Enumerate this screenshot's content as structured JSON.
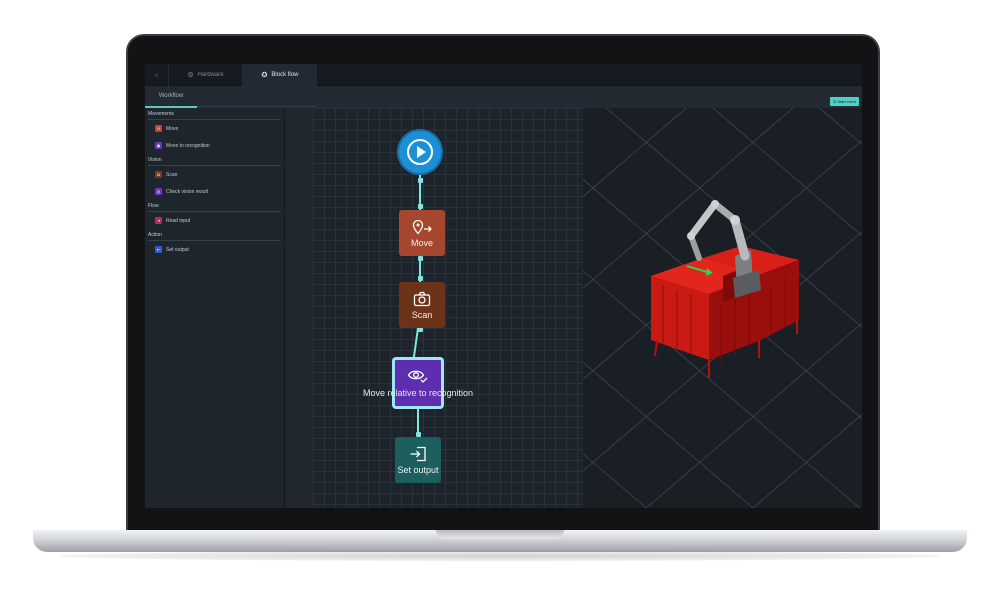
{
  "tabs": {
    "home_icon": "home-icon",
    "hardware_label": "Hardware",
    "block_flow_label": "Block flow"
  },
  "subbar": {
    "workflow_tab": "Workflow",
    "start_robot": "Start robot"
  },
  "palette": {
    "categories": [
      {
        "label": "Movements",
        "items": [
          {
            "label": "Move",
            "icon": "move-icon",
            "color": "#c0452b"
          },
          {
            "label": "Move to recognition",
            "icon": "recognition-icon",
            "color": "#6a35c4"
          }
        ]
      },
      {
        "label": "Vision",
        "items": [
          {
            "label": "Scan",
            "icon": "camera-icon",
            "color": "#7a3c1c"
          },
          {
            "label": "Check vision result",
            "icon": "eye-check-icon",
            "color": "#6a35c4"
          }
        ]
      },
      {
        "label": "Flow",
        "items": [
          {
            "label": "Read input",
            "icon": "input-icon",
            "color": "#b02a5a"
          }
        ]
      },
      {
        "label": "Action",
        "items": [
          {
            "label": "Set output",
            "icon": "output-icon",
            "color": "#2f5fc4"
          }
        ]
      }
    ]
  },
  "flow": {
    "start_icon": "play-icon",
    "nodes": {
      "move": {
        "label": "Move",
        "icon": "location-arrow-icon"
      },
      "scan": {
        "label": "Scan",
        "icon": "camera-icon"
      },
      "move_relative": {
        "label": "Move relative to recognition",
        "icon": "eye-check-icon"
      },
      "set_output": {
        "label": "Set output",
        "icon": "output-icon"
      }
    }
  },
  "colors": {
    "accent": "#4fd1c5",
    "connector": "#7fe6e0",
    "start_node": "#1c8fd6",
    "move": "#a4472e",
    "scan": "#6c3318",
    "move_relative": "#5d2fb0",
    "set_output": "#1d5f5f",
    "cell_red": "#c91a14"
  }
}
